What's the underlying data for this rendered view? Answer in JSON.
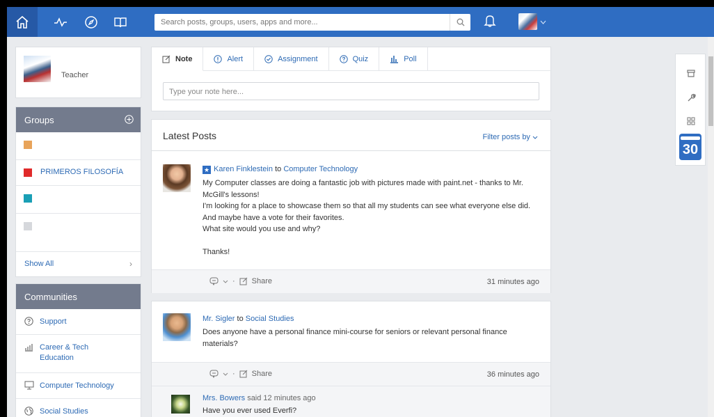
{
  "colors": {
    "topbar": "#2f6dc2",
    "link": "#2d6ab4",
    "panel_header": "#737b8d"
  },
  "topbar": {
    "nav_icons": [
      "home-icon",
      "activity-icon",
      "discover-icon",
      "library-icon"
    ],
    "search_placeholder": "Search posts, groups, users, apps and more...",
    "icons": [
      "search-icon",
      "bell-icon",
      "avatar",
      "chevron-down-icon"
    ]
  },
  "profile": {
    "role": "Teacher"
  },
  "groups": {
    "title": "Groups",
    "items": [
      {
        "color": "#e8a45a",
        "label": ""
      },
      {
        "color": "#e02a2a",
        "label": "PRIMEROS FILOSOFÍA"
      },
      {
        "color": "#1a9fb5",
        "label": ""
      },
      {
        "color": "#d6d8dc",
        "label": ""
      }
    ],
    "show_all": "Show All"
  },
  "communities": {
    "title": "Communities",
    "items": [
      {
        "icon": "question-circle-icon",
        "label": "Support"
      },
      {
        "icon": "chart-icon",
        "label": "Career & Tech Education"
      },
      {
        "icon": "monitor-icon",
        "label": "Computer Technology"
      },
      {
        "icon": "globe-icon",
        "label": "Social Studies"
      }
    ]
  },
  "composer": {
    "tabs": [
      {
        "icon": "note-icon",
        "label": "Note"
      },
      {
        "icon": "alert-icon",
        "label": "Alert"
      },
      {
        "icon": "check-circle-icon",
        "label": "Assignment"
      },
      {
        "icon": "quiz-icon",
        "label": "Quiz"
      },
      {
        "icon": "poll-icon",
        "label": "Poll"
      }
    ],
    "placeholder": "Type your note here..."
  },
  "feed": {
    "title": "Latest Posts",
    "filter": "Filter posts by",
    "posts": [
      {
        "author": "Karen Finklestein",
        "to_word": "to",
        "group": "Computer Technology",
        "lines": [
          "My Computer classes are doing a fantastic job with pictures made with paint.net - thanks to Mr.",
          "McGill's lessons!",
          "I'm looking for a place to showcase them so that all my students can see what everyone else did.",
          "And maybe have a vote for their favorites.",
          "What site would you use and why?",
          "",
          "Thanks!"
        ],
        "share": "Share",
        "time": "31 minutes ago"
      },
      {
        "author": "Mr. Sigler",
        "to_word": "to",
        "group": "Social Studies",
        "lines": [
          "Does anyone have a personal finance mini-course for seniors or relevant personal finance",
          "materials?"
        ],
        "share": "Share",
        "time": "36 minutes ago"
      }
    ],
    "reply": {
      "author": "Mrs. Bowers",
      "said": "said 12 minutes ago",
      "text": "Have you ever used Everfi?"
    }
  },
  "rail": {
    "icons": [
      "store-icon",
      "wrench-icon",
      "apps-grid-icon"
    ],
    "calendar_day": "30"
  }
}
